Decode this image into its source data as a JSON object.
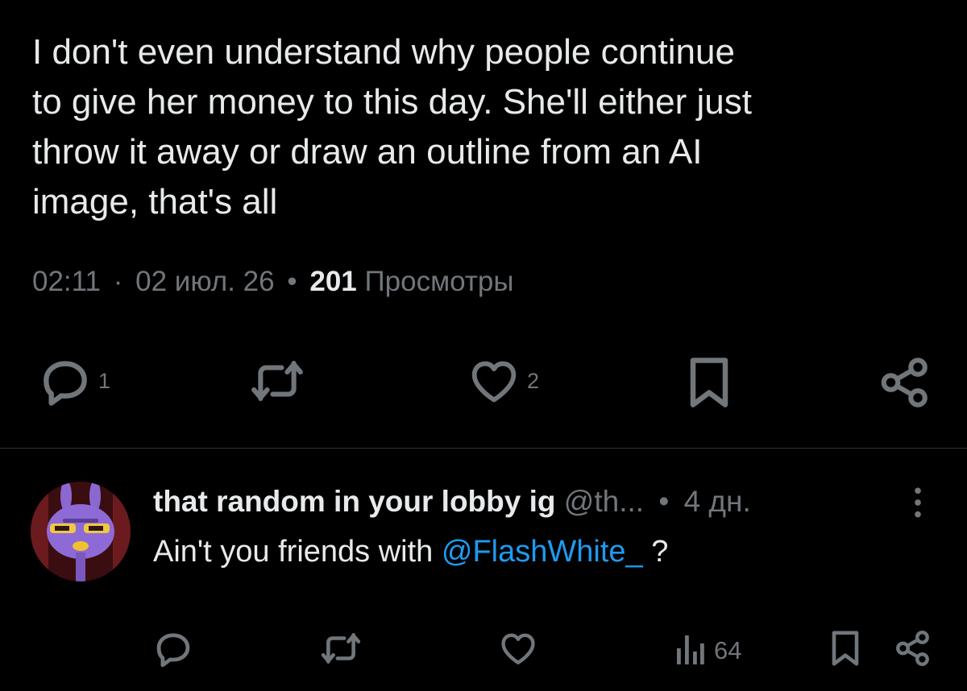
{
  "tweet": {
    "text": "I don't even understand why people continue\nto give her money to this day. She'll either just\nthrow it away or draw an outline from an AI\nimage, that's all",
    "time": "02:11",
    "separator": "·",
    "date": "02 июл. 26",
    "bullet": "•",
    "views_count": "201",
    "views_label": "Просмотры"
  },
  "actions": {
    "reply_count": "1",
    "like_count": "2"
  },
  "reply": {
    "display_name": "that random in your lobby ig",
    "handle": "@th...",
    "bullet": "•",
    "age": "4 дн.",
    "text_before": "Ain't you friends with ",
    "mention": "@FlashWhite_",
    "text_after": " ?",
    "views_count": "64"
  },
  "colors": {
    "background": "#000000",
    "text_primary": "#e7e9ea",
    "text_secondary": "#71767b",
    "link": "#1d9bf0",
    "divider": "#2f3336"
  },
  "icons": [
    "reply-icon",
    "retweet-icon",
    "like-icon",
    "bookmark-icon",
    "share-icon",
    "more-icon",
    "views-icon"
  ]
}
